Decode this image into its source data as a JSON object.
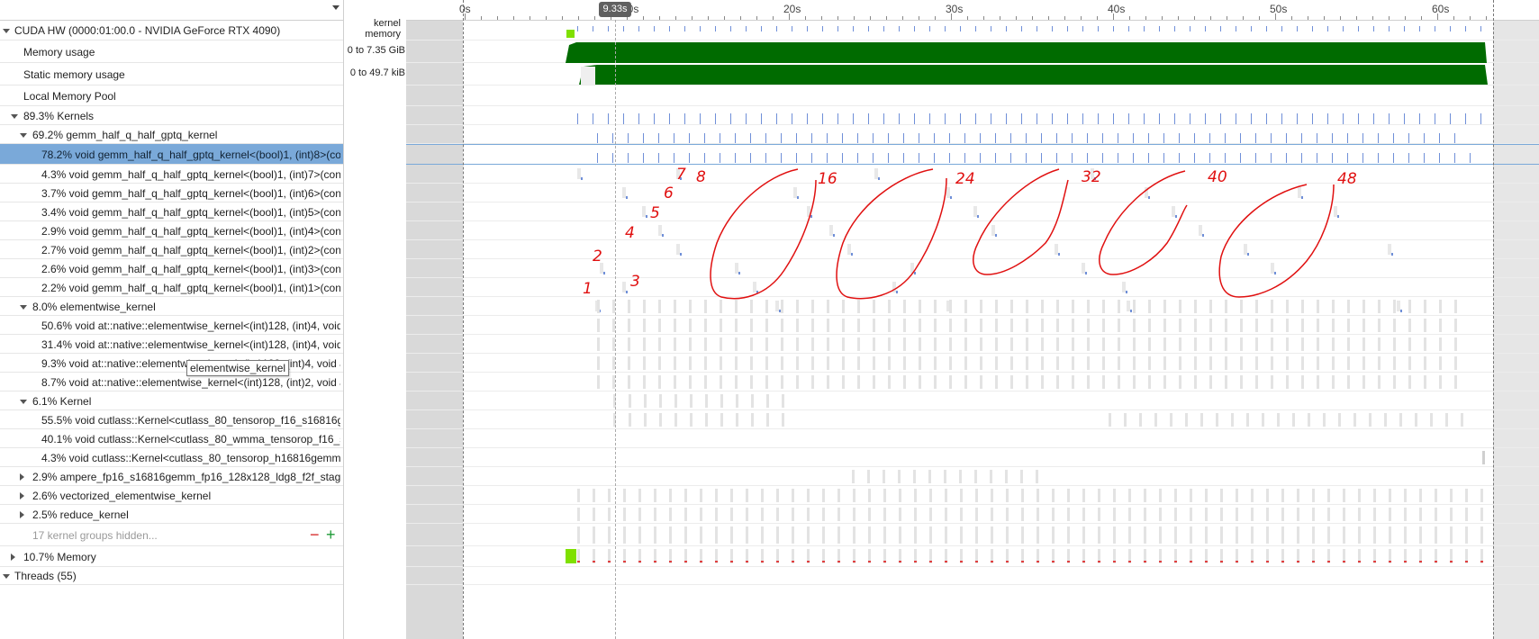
{
  "header": {
    "filter_icon": "chevron-down-icon"
  },
  "ruler": {
    "ticks": [
      "0s",
      "10s",
      "20s",
      "30s",
      "40s",
      "50s",
      "60s"
    ],
    "cursor_time": "9.33s"
  },
  "column_header": {
    "line1": "kernel",
    "line2": "memory"
  },
  "rows": [
    {
      "label": "CUDA HW (0000:01:00.0 - NVIDIA GeForce RTX 4090)",
      "expander": "down",
      "indent": 0
    },
    {
      "label": "Memory usage",
      "range": "0 to 7.35 GiB",
      "indent": 1
    },
    {
      "label": "Static memory usage",
      "range": "0 to 49.7 kiB",
      "indent": 1
    },
    {
      "label": "Local Memory Pool",
      "indent": 1
    },
    {
      "label": "89.3% Kernels",
      "expander": "down",
      "indent": 1
    },
    {
      "label": "69.2% gemm_half_q_half_gptq_kernel",
      "expander": "down",
      "indent": 2
    },
    {
      "label": "78.2% void gemm_half_q_half_gptq_kernel<(bool)1, (int)8>(cor",
      "indent": 3,
      "selected": true
    },
    {
      "label": "4.3% void gemm_half_q_half_gptq_kernel<(bool)1, (int)7>(cons",
      "indent": 3
    },
    {
      "label": "3.7% void gemm_half_q_half_gptq_kernel<(bool)1, (int)6>(cons",
      "indent": 3
    },
    {
      "label": "3.4% void gemm_half_q_half_gptq_kernel<(bool)1, (int)5>(cons",
      "indent": 3
    },
    {
      "label": "2.9% void gemm_half_q_half_gptq_kernel<(bool)1, (int)4>(cons",
      "indent": 3
    },
    {
      "label": "2.7% void gemm_half_q_half_gptq_kernel<(bool)1, (int)2>(cons",
      "indent": 3
    },
    {
      "label": "2.6% void gemm_half_q_half_gptq_kernel<(bool)1, (int)3>(cons",
      "indent": 3
    },
    {
      "label": "2.2% void gemm_half_q_half_gptq_kernel<(bool)1, (int)1>(cons",
      "indent": 3
    },
    {
      "label": "8.0% elementwise_kernel",
      "expander": "down",
      "indent": 2
    },
    {
      "label": "50.6% void at::native::elementwise_kernel<(int)128, (int)4, void",
      "indent": 3
    },
    {
      "label": "31.4% void at::native::elementwise_kernel<(int)128, (int)4, void",
      "indent": 3
    },
    {
      "label": "9.3% void at::native::elementwise_kernel<(int)128, (int)4, void a",
      "indent": 3
    },
    {
      "label": "8.7% void at::native::elementwise_kernel<(int)128, (int)2, void a",
      "indent": 3
    },
    {
      "label": "6.1% Kernel",
      "expander": "down",
      "indent": 2
    },
    {
      "label": "55.5% void cutlass::Kernel<cutlass_80_tensorop_f16_s16816g",
      "indent": 3
    },
    {
      "label": "40.1% void cutlass::Kernel<cutlass_80_wmma_tensorop_f16_s",
      "indent": 3
    },
    {
      "label": "4.3% void cutlass::Kernel<cutlass_80_tensorop_h16816gemm",
      "indent": 3
    },
    {
      "label": "2.9% ampere_fp16_s16816gemm_fp16_128x128_ldg8_f2f_stage",
      "expander": "right",
      "indent": 2
    },
    {
      "label": "2.6% vectorized_elementwise_kernel",
      "expander": "right",
      "indent": 2
    },
    {
      "label": "2.5% reduce_kernel",
      "expander": "right",
      "indent": 2
    },
    {
      "label": "17 kernel groups hidden...",
      "indent": 2,
      "hidden_note": true
    },
    {
      "label": "10.7% Memory",
      "expander": "right",
      "indent": 1
    },
    {
      "label": "Threads (55)",
      "expander": "down",
      "indent": 0
    }
  ],
  "hidden_controls": {
    "minus": "−",
    "plus": "+"
  },
  "tooltip": "elementwise_kernel",
  "annotations": [
    "1",
    "2",
    "3",
    "4",
    "5",
    "6",
    "7",
    "8",
    "16",
    "24",
    "32",
    "40",
    "48"
  ],
  "colors": {
    "memory": "#006b00",
    "memory_start": "#7fe000",
    "kernel": "#6f8fd8",
    "annotation": "#e01010",
    "selected": "#7aa9d9"
  }
}
